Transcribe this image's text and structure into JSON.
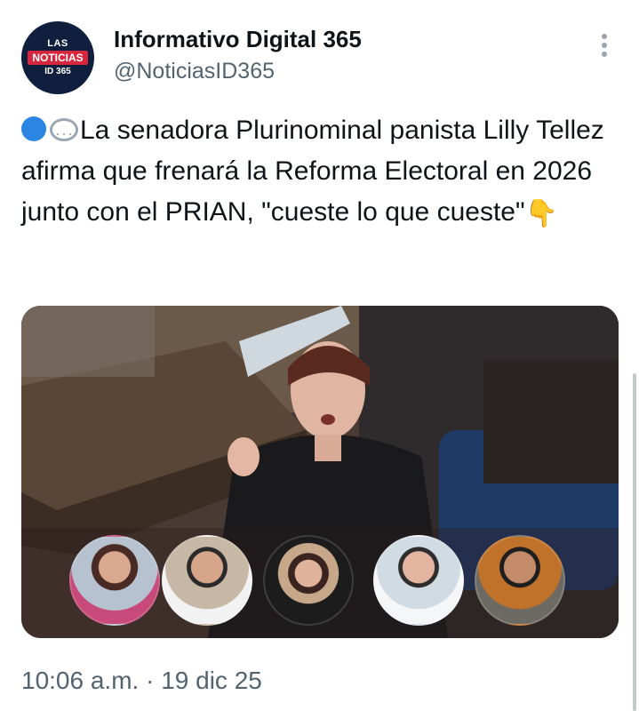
{
  "author": {
    "display_name": "Informativo Digital 365",
    "handle": "@NoticiasID365",
    "avatar_logo": {
      "line1": "LAS",
      "line2": "NOTICIAS",
      "line3": "ID 365"
    }
  },
  "tweet": {
    "text": "La senadora Plurinominal panista Lilly Tellez afirma que frenará la Reforma Electoral en 2026 junto con el PRIAN, \"cueste lo que cueste\"",
    "leading_emojis": [
      "blue-circle-emoji",
      "speech-bubble-emoji"
    ],
    "trailing_emoji": "pointing-down-emoji"
  },
  "meta": {
    "time": "10:06 a.m.",
    "separator": " · ",
    "date": "19 dic 25"
  },
  "icons": {
    "more": "more-options-icon"
  },
  "colors": {
    "text_primary": "#0f1419",
    "text_secondary": "#536471",
    "blue_emoji": "#2b86e3"
  }
}
